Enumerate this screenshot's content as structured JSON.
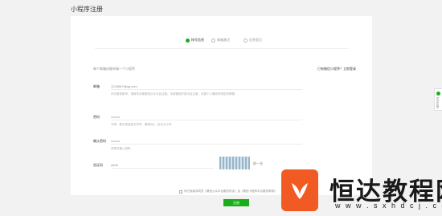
{
  "page": {
    "title": "小程序注册"
  },
  "steps": [
    {
      "label": "帐号信息",
      "active": true
    },
    {
      "label": "邮箱激活",
      "active": false
    },
    {
      "label": "信息登记",
      "active": false
    }
  ],
  "notice": {
    "left": "每个邮箱仅能申请一个小程序",
    "right": "已有微信小程序？立即登录"
  },
  "form": {
    "email": {
      "label": "邮箱",
      "value": "作为登录帐号，请填写未被微信公众平台注册，未被微信开放平台注册，未被个人微信号绑定的邮箱",
      "placeholder": "1234567@qq.com"
    },
    "password": {
      "label": "密码",
      "value": "••••••••",
      "hint": "字母、数字或者英文符号，最短8位，区分大小写"
    },
    "confirm": {
      "label": "确认密码",
      "value": "••••••••",
      "hint": "请再次输入密码"
    },
    "captcha": {
      "label": "验证码",
      "value": "a4b5",
      "refresh": "换一张"
    }
  },
  "agreement": {
    "text": "你已阅读并同意《微信公众平台服务协议》及《微信小程序平台服务条款》"
  },
  "register_button": "注册",
  "float_tab": {
    "label": "意见反馈"
  },
  "watermark": {
    "title": "恒达教程网",
    "url": "w w w . s x h d c j . c o m",
    "logo_color": "#f15a22"
  },
  "colors": {
    "accent": "#1aad19"
  }
}
